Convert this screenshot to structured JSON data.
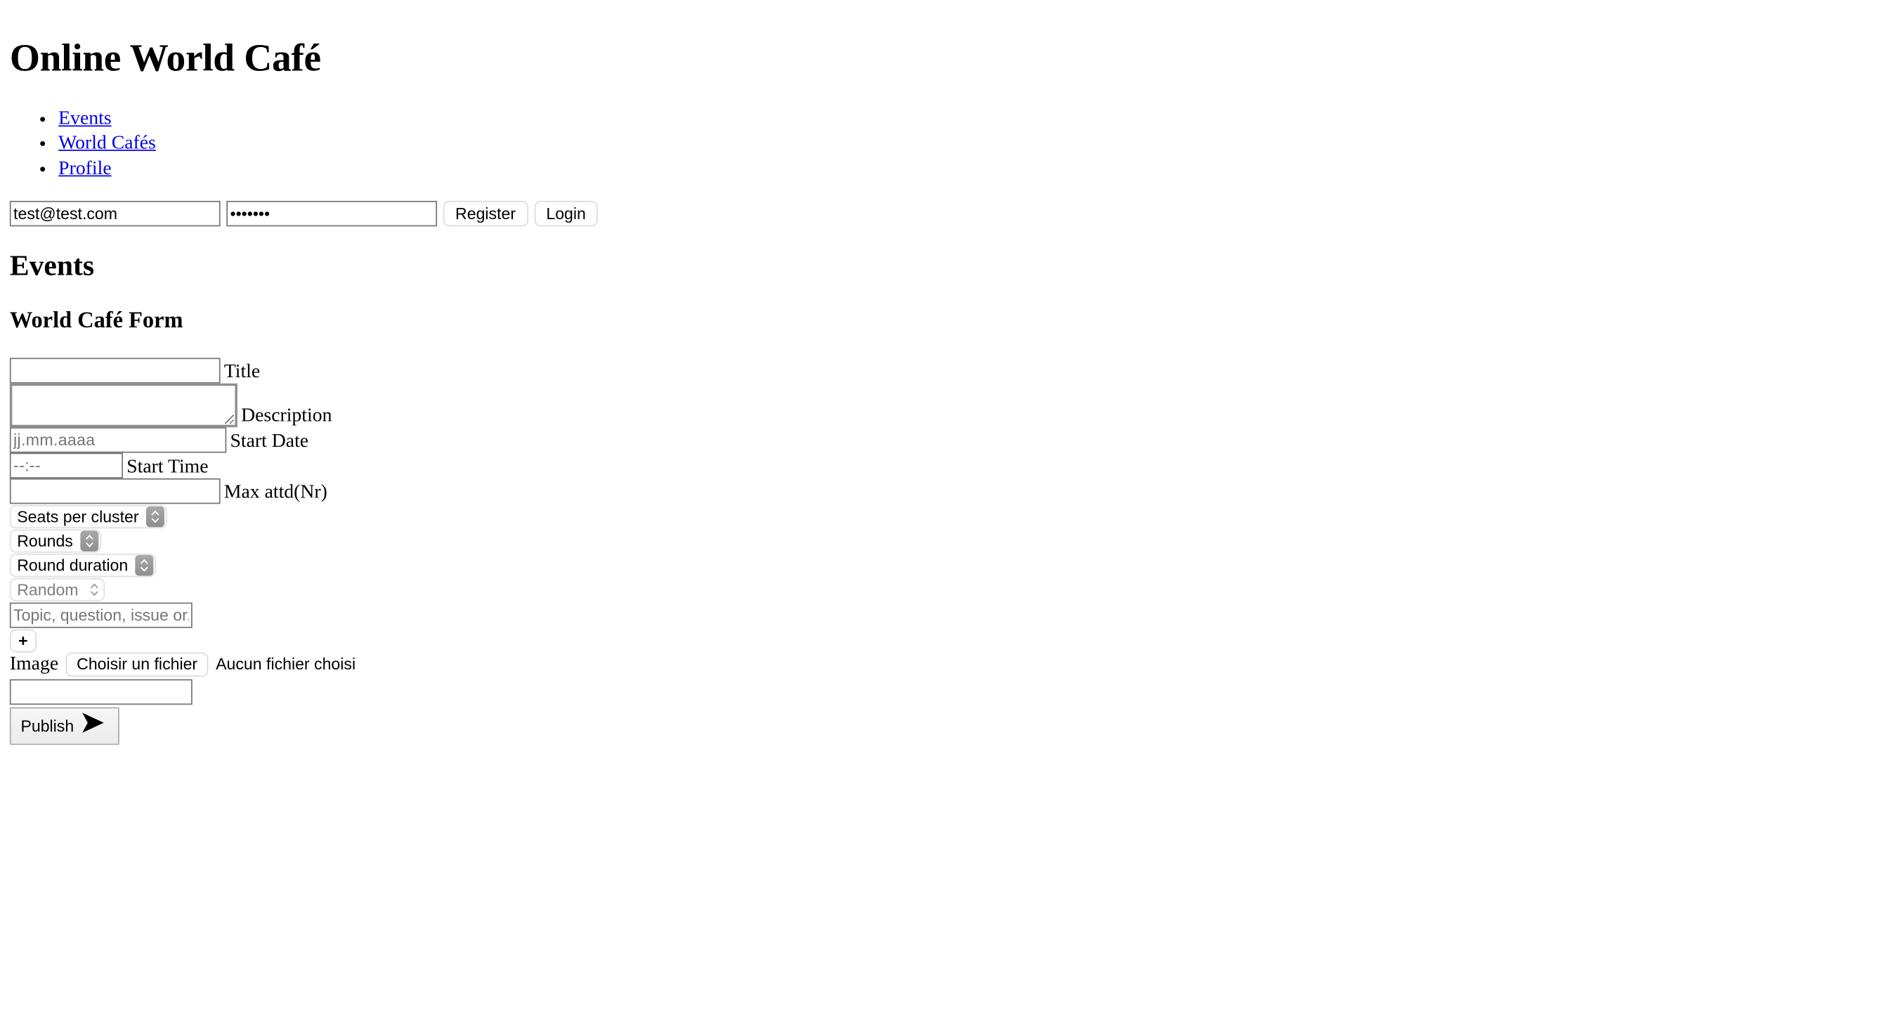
{
  "site": {
    "title": "Online World Café"
  },
  "nav": {
    "items": [
      {
        "label": "Events"
      },
      {
        "label": "World Cafés"
      },
      {
        "label": "Profile"
      }
    ]
  },
  "auth": {
    "email": {
      "value": "test@test.com",
      "placeholder": ""
    },
    "password": {
      "value": "•••••••",
      "placeholder": ""
    },
    "register_label": "Register",
    "login_label": "Login"
  },
  "main": {
    "page_heading": "Events",
    "form_heading": "World Café Form",
    "fields": {
      "title": {
        "label": "Title",
        "value": "",
        "placeholder": ""
      },
      "description": {
        "label": "Description",
        "value": "",
        "placeholder": ""
      },
      "start_date": {
        "label": "Start Date",
        "value": "",
        "placeholder": "jj.mm.aaaa"
      },
      "start_time": {
        "label": "Start Time",
        "value": "",
        "placeholder": "--:--"
      },
      "max_attendees": {
        "label": "Max attd(Nr)",
        "value": "",
        "placeholder": ""
      },
      "seats_per_cluster": {
        "selected": "Seats per cluster",
        "disabled": false
      },
      "rounds": {
        "selected": "Rounds",
        "disabled": false
      },
      "round_duration": {
        "selected": "Round duration",
        "disabled": false
      },
      "assignment_mode": {
        "selected": "Random",
        "disabled": true
      },
      "topic": {
        "value": "",
        "placeholder": "Topic, question, issue or..."
      },
      "add_topic_label": "+",
      "image": {
        "label": "Image",
        "choose_file_label": "Choisir un fichier",
        "file_status": "Aucun fichier choisi"
      },
      "image_url": {
        "value": "",
        "placeholder": ""
      }
    },
    "publish": {
      "label": "Publish",
      "arrow_glyph": "➤"
    }
  },
  "colors": {
    "link": "#0000EE",
    "text": "#000000",
    "background": "#ffffff",
    "input_border": "#767676",
    "select_arrow_bg": "#8e8e8e"
  }
}
